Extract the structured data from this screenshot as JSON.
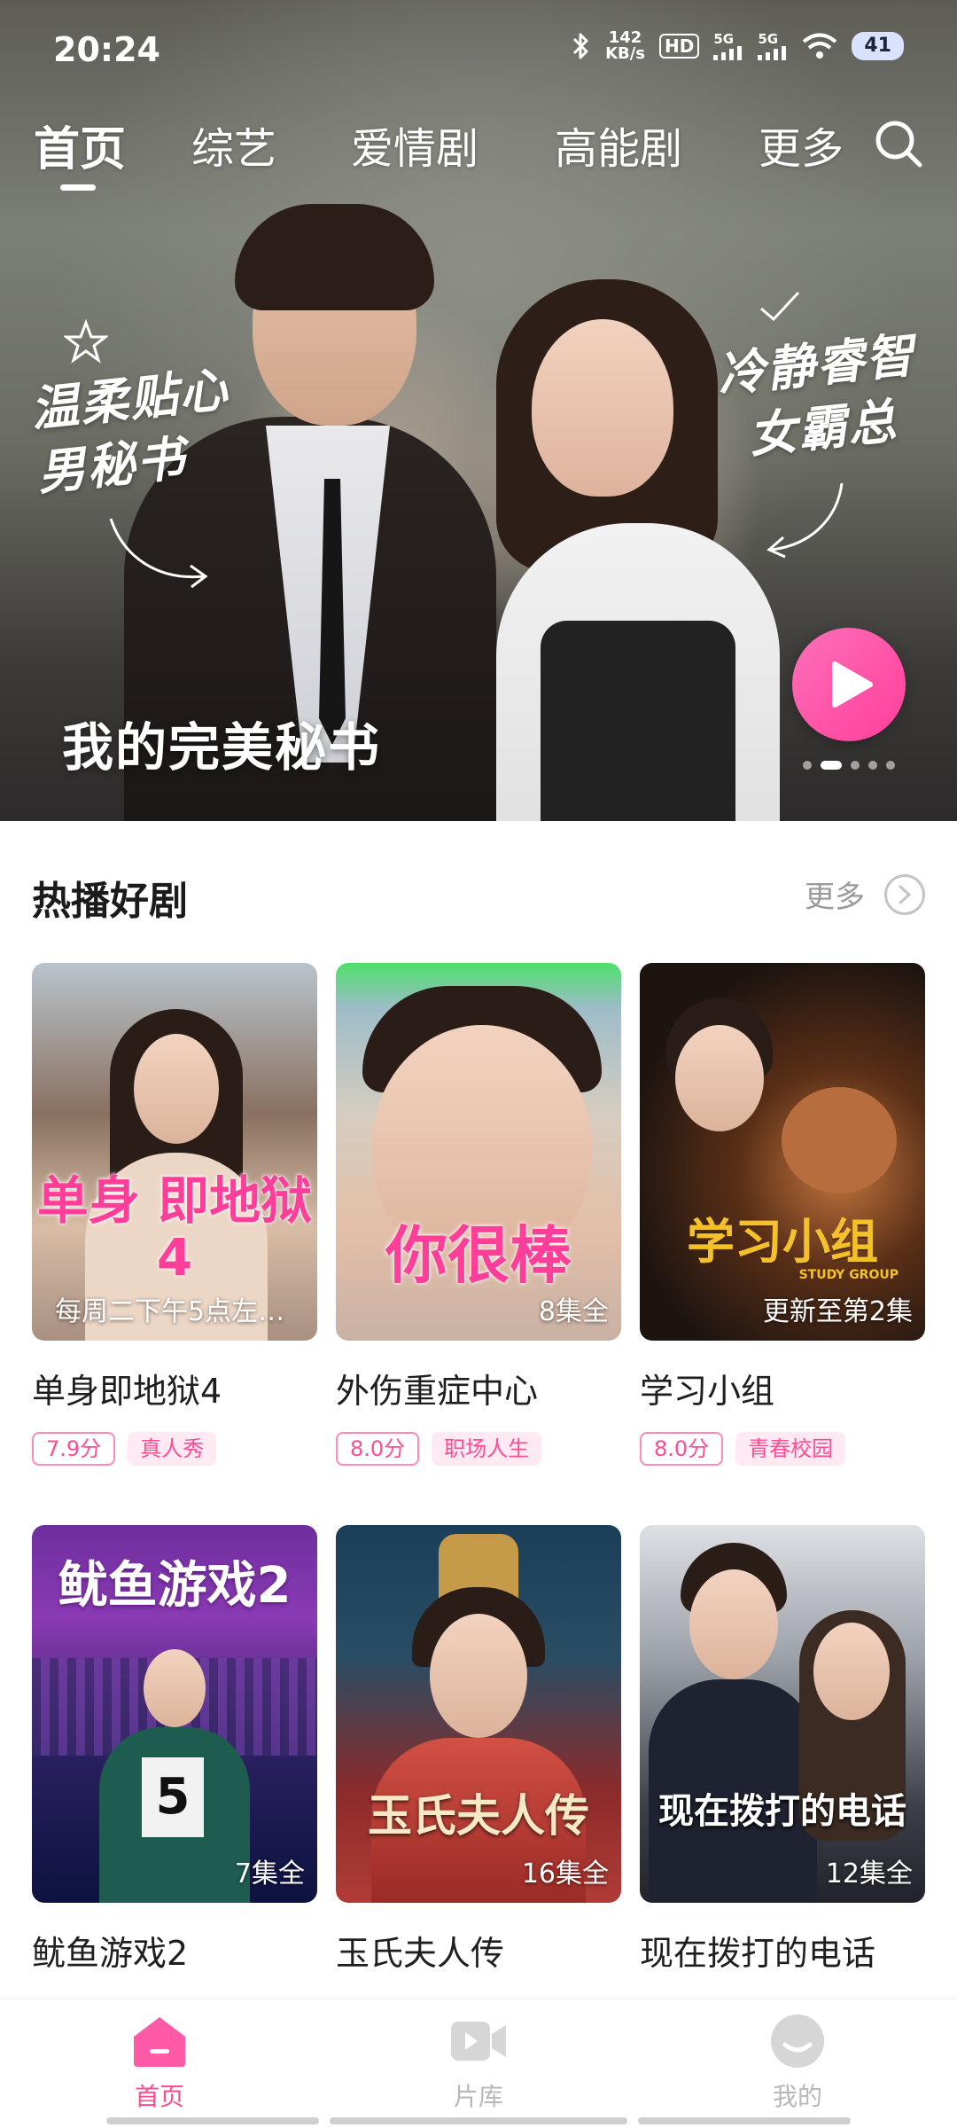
{
  "status_bar": {
    "time": "20:24",
    "speed_value": "142",
    "speed_unit": "KB/s",
    "hd_label": "HD",
    "net1": "5G",
    "net2": "5G",
    "battery": "41"
  },
  "top_tabs": [
    "首页",
    "综艺",
    "爱情剧",
    "高能剧",
    "更多"
  ],
  "hero": {
    "title": "我的完美秘书",
    "note_left": "温柔贴心 男秘书",
    "note_right": "冷静睿智 女霸总",
    "slide_count": 5,
    "active_slide": 1
  },
  "section": {
    "title": "热播好剧",
    "more_label": "更多"
  },
  "cards": [
    {
      "title": "单身即地狱4",
      "caption": "每周二下午5点左…",
      "art_text": "单身 即地狱4",
      "score": "7.9分",
      "genre": "真人秀"
    },
    {
      "title": "外伤重症中心",
      "caption": "8集全",
      "art_text": "你很棒",
      "score": "8.0分",
      "genre": "职场人生"
    },
    {
      "title": "学习小组",
      "caption": "更新至第2集",
      "art_text": "学习小组",
      "art_sub": "STUDY GROUP",
      "score": "8.0分",
      "genre": "青春校园"
    },
    {
      "title": "鱿鱼游戏2",
      "caption": "7集全",
      "art_text": "鱿鱼游戏2",
      "score": "",
      "genre": ""
    },
    {
      "title": "玉氏夫人传",
      "caption": "16集全",
      "art_text": "玉氏夫人传",
      "score": "",
      "genre": ""
    },
    {
      "title": "现在拨打的电话",
      "caption": "12集全",
      "art_text": "现在拨打的电话",
      "score": "",
      "genre": ""
    }
  ],
  "bottom_nav": [
    {
      "label": "首页",
      "icon": "home-icon",
      "active": true
    },
    {
      "label": "片库",
      "icon": "video-library-icon",
      "active": false
    },
    {
      "label": "我的",
      "icon": "profile-icon",
      "active": false
    }
  ],
  "colors": {
    "accent": "#ff4d94",
    "accent_light": "#ffeaf3",
    "play_button": "#ff5aa8",
    "inactive": "#b8b8b8"
  }
}
